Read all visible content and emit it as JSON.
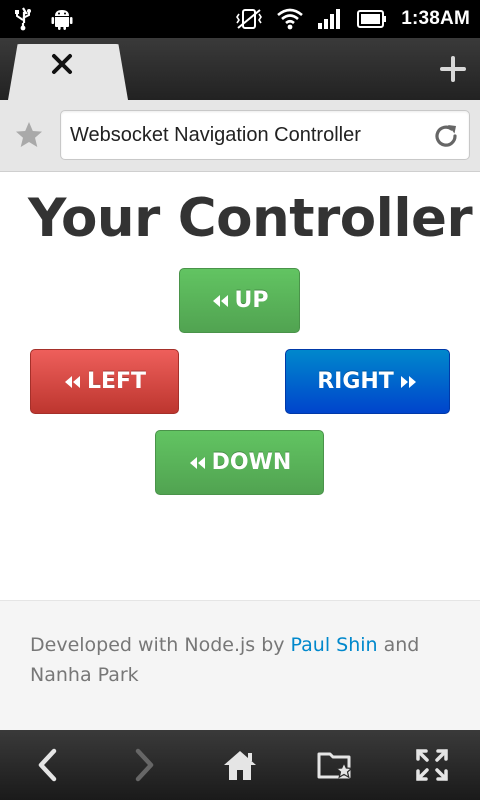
{
  "status_bar": {
    "time": "1:38AM",
    "left_icons": [
      "usb-icon",
      "android-icon"
    ],
    "right_icons": [
      "vibrate-off-icon",
      "wifi-icon",
      "signal-icon",
      "battery-icon"
    ]
  },
  "browser": {
    "tab_close_icon": "close-icon",
    "new_tab_icon": "plus-icon",
    "address_text": "Websocket Navigation Controller",
    "bookmark_icon": "star-icon",
    "reload_icon": "reload-icon"
  },
  "page": {
    "title": "Your Controller",
    "buttons": {
      "up": "UP",
      "left": "LEFT",
      "right": "RIGHT",
      "down": "DOWN"
    },
    "colors": {
      "green": "#5bb75b",
      "red": "#da4f49",
      "blue": "#0066cc",
      "link": "#0088cc"
    }
  },
  "footer": {
    "prefix": "Developed with Node.js by ",
    "author1": "Paul Shin",
    "middle": " and",
    "author2": "Nanha Park"
  },
  "bottom_nav": {
    "icons": [
      "back-icon",
      "forward-icon",
      "home-icon",
      "bookmarks-icon",
      "fullscreen-icon"
    ]
  }
}
